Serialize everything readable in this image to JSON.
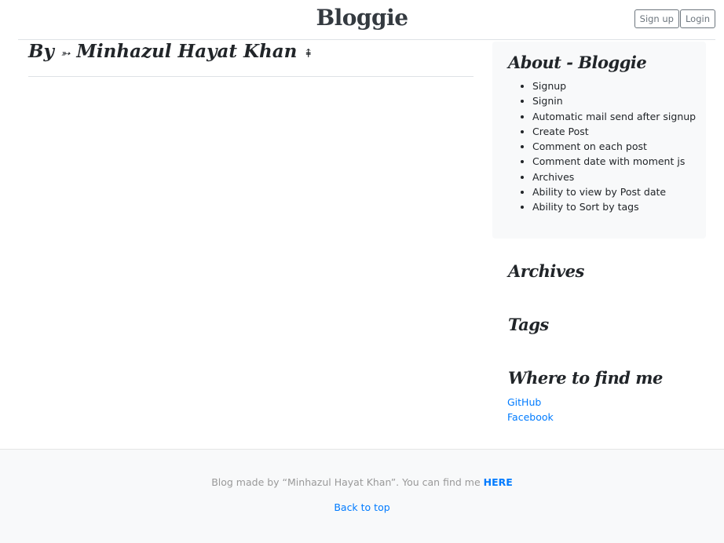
{
  "header": {
    "brand": "Bloggie",
    "signup_label": "Sign up",
    "login_label": "Login"
  },
  "main": {
    "title_prefix": "By",
    "arrow_left": "➳",
    "author": "Minhazul Hayat Khan",
    "arrow_right": "⇞"
  },
  "sidebar": {
    "about_title": "About - Bloggie",
    "about_items": [
      "Signup",
      "Signin",
      "Automatic mail send after signup",
      "Create Post",
      "Comment on each post",
      "Comment date with moment js",
      "Archives",
      "Ability to view by Post date",
      "Ability to Sort by tags"
    ],
    "archives_title": "Archives",
    "tags_title": "Tags",
    "where_title": "Where to find me",
    "links": [
      "GitHub",
      "Facebook"
    ]
  },
  "footer": {
    "text": "Blog made by “Minhazul Hayat Khan”. You can find me",
    "here_link": "HERE",
    "back_to_top": "Back to top"
  }
}
